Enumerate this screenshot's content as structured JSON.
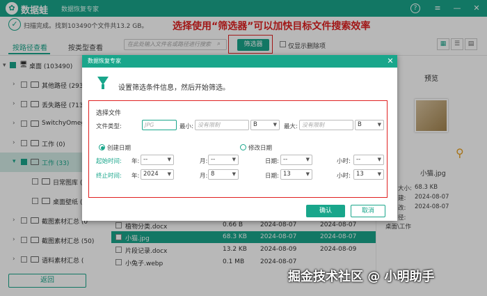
{
  "header": {
    "app_name": "数据蛙",
    "subtitle": "数据恢复专家",
    "help": "?",
    "menu": "≡",
    "minimize": "—",
    "close": "✕"
  },
  "status": {
    "text": "扫描完成。找到103490个文件共13.2 GB。"
  },
  "annotation": "选择使用“筛选器”可以加快目标文件搜索效率",
  "tabs": [
    {
      "label": "按路径查看"
    },
    {
      "label": "按类型查看"
    }
  ],
  "toolbar": {
    "search_placeholder": "在此处输入文件名或路径进行搜索",
    "filter_label": "筛选器",
    "only_deleted_label": "仅显示删除项"
  },
  "tree": [
    {
      "label": "桌面 (103490)"
    },
    {
      "label": "其他路径 (2935"
    },
    {
      "label": "丢失路径 (7139"
    },
    {
      "label": "SwitchyOmega"
    },
    {
      "label": "工作 (0)"
    },
    {
      "label": "工作 (33)"
    },
    {
      "label": "日常图库 (2"
    },
    {
      "label": "桌面壁纸 (1"
    },
    {
      "label": "截图素材汇总 (0"
    },
    {
      "label": "截图素材汇总 (50)"
    },
    {
      "label": "语料素材汇总 ("
    }
  ],
  "files": [
    {
      "name": "植物分类.docx",
      "size": "0.66 B",
      "date": "2024-08-07",
      "date2": "2024-08-07"
    },
    {
      "name": "小猫.jpg",
      "size": "68.3 KB",
      "date": "2024-08-07",
      "date2": "2024-08-07"
    },
    {
      "name": "片段记录.docx",
      "size": "13.2 KB",
      "date": "2024-08-09",
      "date2": "2024-08-09"
    },
    {
      "name": "小兔子.webp",
      "size": "0.1 MB",
      "date": "2024-08-07",
      "date2": "2024-08-07"
    }
  ],
  "preview": {
    "title": "预览",
    "filename": "小猫.jpg",
    "meta": [
      {
        "label": "大小:",
        "value": "68.3 KB"
      },
      {
        "label": "建:",
        "value": "2024-08-07"
      },
      {
        "label": "改:",
        "value": "2024-08-07"
      },
      {
        "label": "径:",
        "value": "桌面\\工作"
      }
    ]
  },
  "back_label": "返回",
  "watermark": "掘金技术社区 @ 小明助手",
  "dialog": {
    "title": "数据恢复专家",
    "close": "✕",
    "description": "设置筛选条件信息，然后开始筛选。",
    "section_title": "选择文件",
    "file_type_label": "文件类型:",
    "file_type_placeholder": "JPG",
    "min_label": "最小:",
    "min_placeholder": "没有限制",
    "min_unit": "B",
    "max_label": "最大:",
    "max_placeholder": "没有限制",
    "max_unit": "B",
    "create_date_label": "创建日期",
    "modify_date_label": "修改日期",
    "start_label": "起始时间:",
    "end_label": "终止时间:",
    "year_label": "年:",
    "month_label": "月:",
    "day_label": "日期:",
    "hour_label": "小时:",
    "start": {
      "year": "--",
      "month": "--",
      "day": "--",
      "hour": "--"
    },
    "end": {
      "year": "2024",
      "month": "8",
      "day": "13",
      "hour": "13"
    },
    "ok_label": "确认",
    "cancel_label": "取消"
  }
}
